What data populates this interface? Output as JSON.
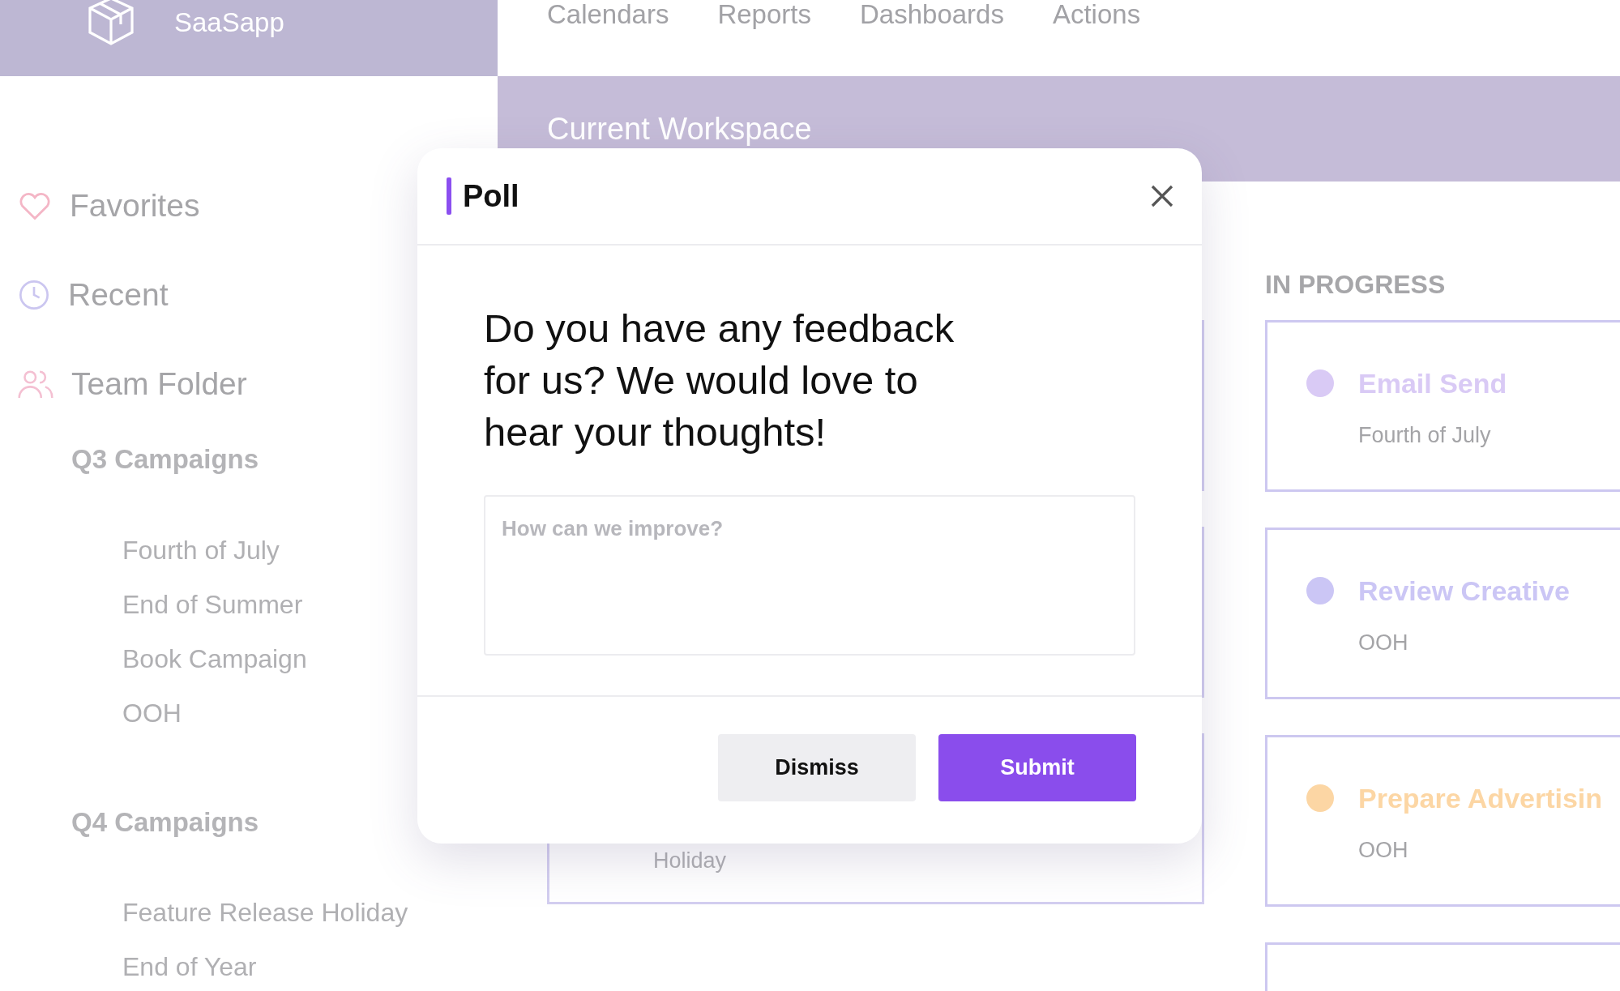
{
  "brand": {
    "name": "SaaSapp"
  },
  "nav": [
    "Calendars",
    "Reports",
    "Dashboards",
    "Actions"
  ],
  "workspace": {
    "title": "Current Workspace"
  },
  "sidebar": {
    "items": [
      {
        "label": "Favorites"
      },
      {
        "label": "Recent"
      },
      {
        "label": "Team Folder"
      }
    ],
    "groups": [
      {
        "title": "Q3 Campaigns",
        "items": [
          "Fourth of July",
          "End of Summer",
          "Book Campaign",
          "OOH"
        ]
      },
      {
        "title": "Q4 Campaigns",
        "items": [
          "Feature Release Holiday",
          "End of Year"
        ]
      }
    ]
  },
  "board": {
    "cards": [
      {
        "kind": "empty"
      },
      {
        "kind": "empty"
      },
      {
        "kind": "task",
        "subtitle": "Holiday"
      }
    ]
  },
  "in_progress": {
    "title": "IN PROGRESS",
    "cards": [
      {
        "kind": "task",
        "title": "Email Send",
        "subtitle": "Fourth of July",
        "color": "#d9caf5"
      },
      {
        "kind": "task",
        "title": "Review Creative",
        "subtitle": "OOH",
        "color": "#cbc6f5"
      },
      {
        "kind": "task",
        "title": "Prepare Advertisin",
        "subtitle": "OOH",
        "color": "#fcd6a4"
      },
      {
        "kind": "blank"
      }
    ]
  },
  "modal": {
    "title": "Poll",
    "question": "Do you have any feedback for us? We would love to hear your thoughts!",
    "placeholder": "How can we improve?",
    "buttons": [
      {
        "label": "Dismiss",
        "kind": "secondary"
      },
      {
        "label": "Submit",
        "kind": "primary"
      }
    ]
  }
}
